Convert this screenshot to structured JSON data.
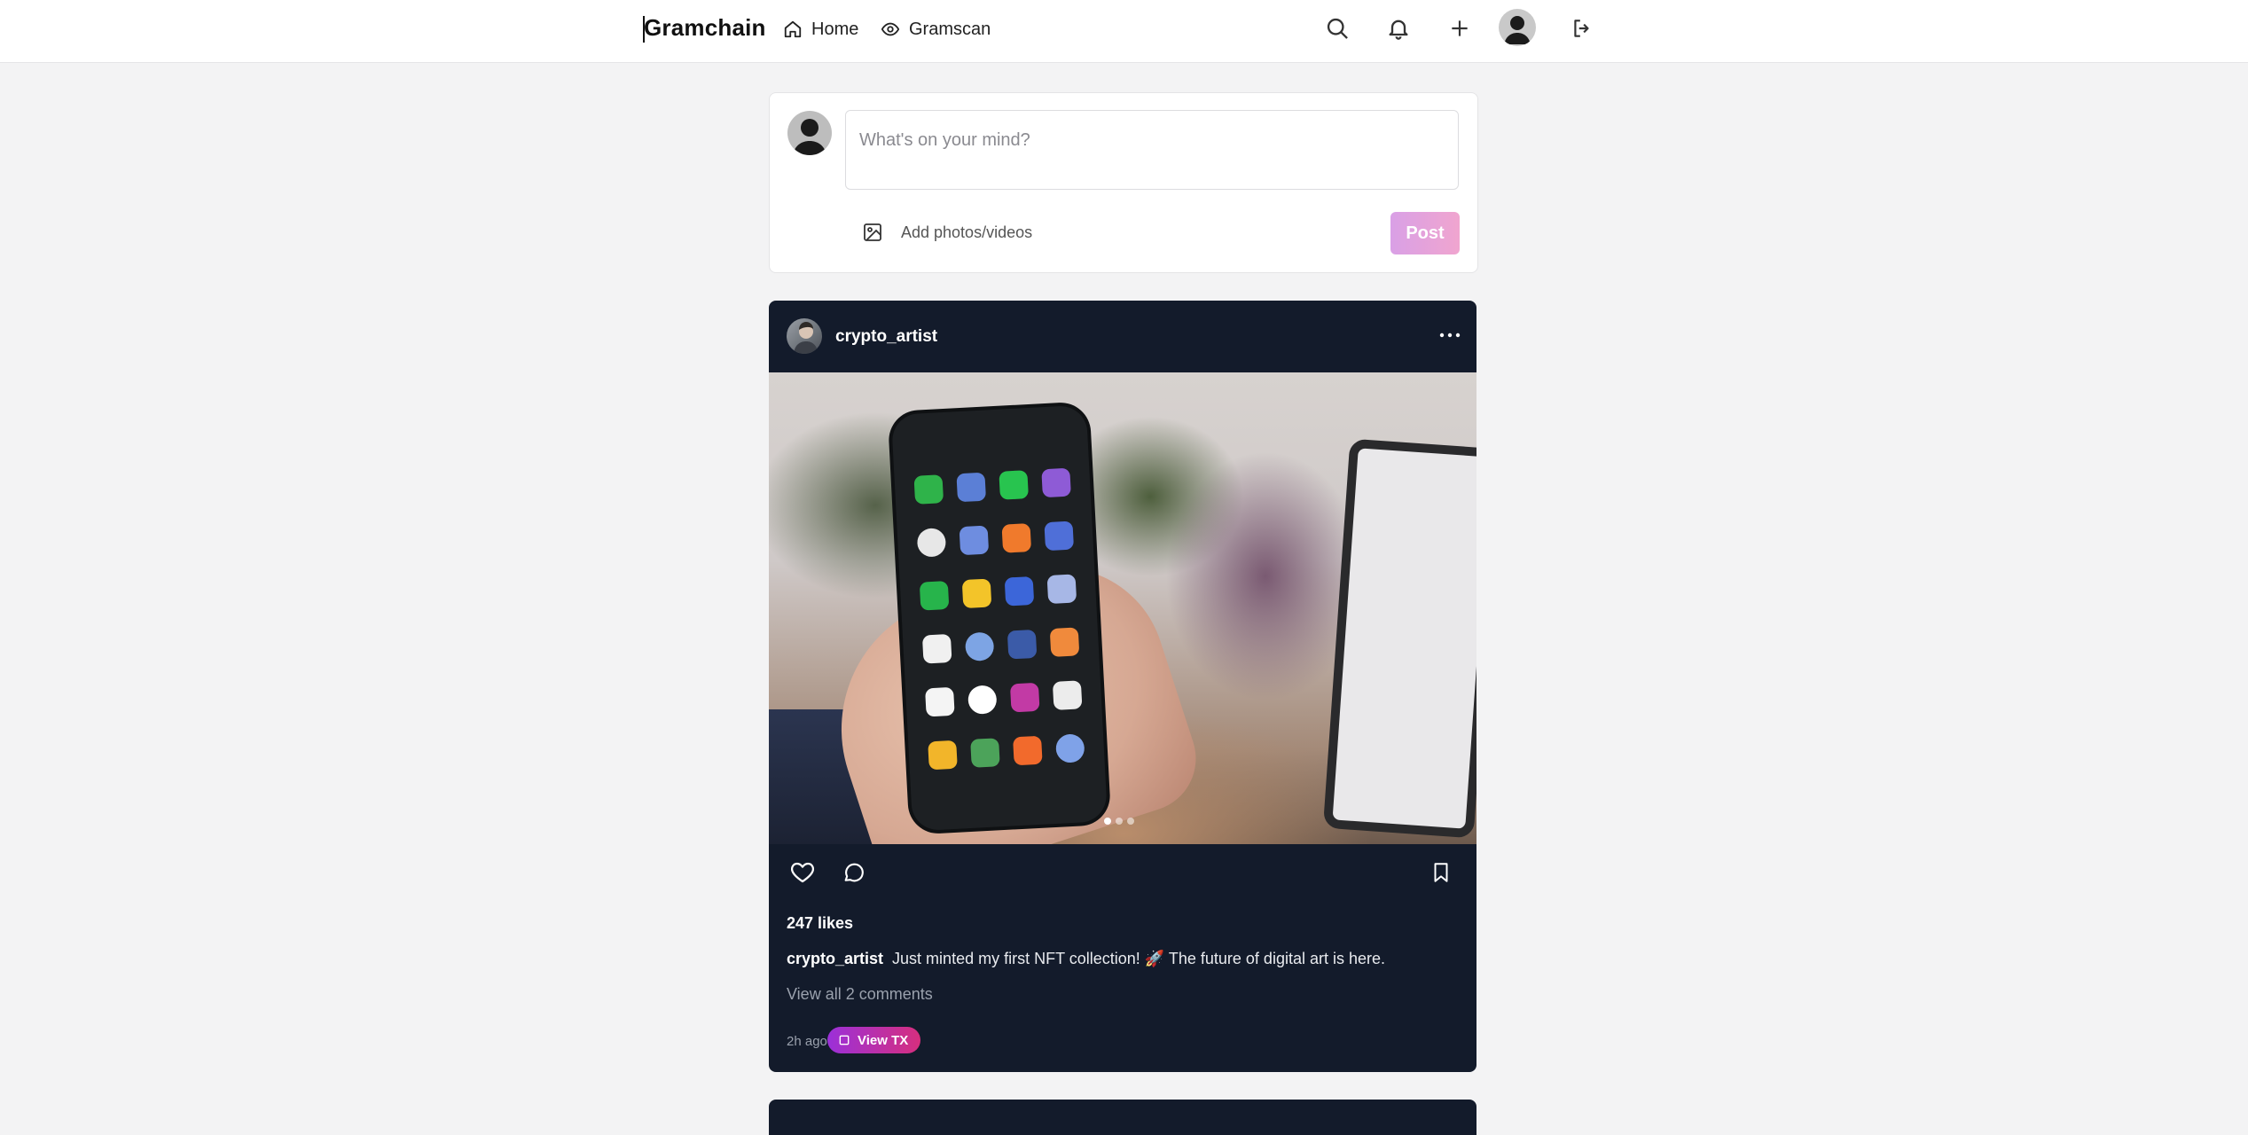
{
  "nav": {
    "brand": "Gramchain",
    "links": [
      {
        "label": "Home",
        "icon": "home-icon"
      },
      {
        "label": "Gramscan",
        "icon": "eye-icon"
      }
    ],
    "actions": [
      "search-icon",
      "bell-icon",
      "plus-icon",
      "avatar",
      "logout-icon"
    ]
  },
  "composer": {
    "placeholder": "What's on your mind?",
    "add_media_label": "Add photos/videos",
    "post_label": "Post"
  },
  "post": {
    "username": "crypto_artist",
    "likes": "247 likes",
    "caption_user": "crypto_artist",
    "caption_text": "Just minted my first NFT collection! 🚀 The future of digital art is here.",
    "comments_link": "View all 2 comments",
    "time": "2h ago",
    "tx_label": "View TX",
    "carousel": {
      "count": 3,
      "active": 1
    }
  },
  "colors": {
    "post_bg": "#131b2b",
    "page_bg": "#f3f3f4",
    "accent_start": "#9b30d9",
    "accent_end": "#d62f7e"
  }
}
